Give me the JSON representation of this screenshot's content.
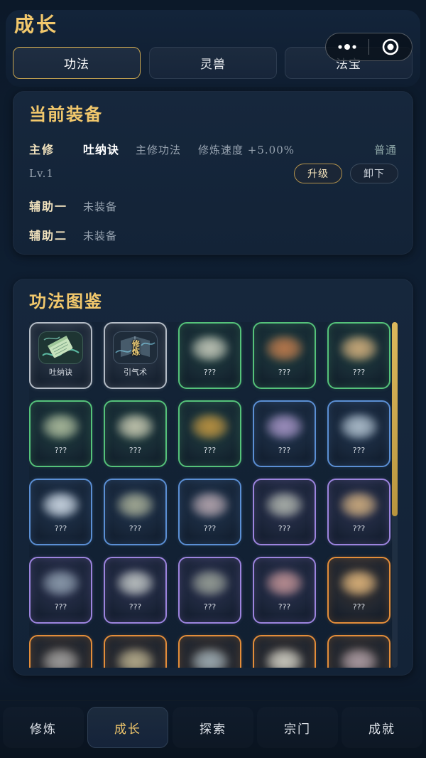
{
  "header": {
    "title": "成长"
  },
  "capsule": {
    "more_icon": "more-dots-icon",
    "close_icon": "target-circle-icon"
  },
  "tabs": [
    {
      "label": "功法",
      "selected": true
    },
    {
      "label": "灵兽",
      "selected": false
    },
    {
      "label": "法宝",
      "selected": false
    }
  ],
  "equipment": {
    "title": "当前装备",
    "main": {
      "slot_label": "主修",
      "name": "吐纳诀",
      "category": "主修功法",
      "effect": "修炼速度 +5.00%",
      "quality": "普通",
      "level": "Lv.1",
      "upgrade_label": "升级",
      "unequip_label": "卸下"
    },
    "aux": [
      {
        "slot_label": "辅助一",
        "value": "未装备"
      },
      {
        "slot_label": "辅助二",
        "value": "未装备"
      }
    ]
  },
  "codex": {
    "title": "功法图鉴",
    "items": [
      {
        "name": "吐纳诀",
        "unlocked": true,
        "icon": "jade-slip-icon",
        "frame_color": "#b4bcc6"
      },
      {
        "name": "引气术",
        "unlocked": true,
        "icon": "cultivation-manual-icon",
        "icon_text": "修炼",
        "frame_color": "#b4bcc6"
      },
      {
        "name": "???",
        "unlocked": false,
        "icon": "blurred-technique-icon",
        "frame_color": "#55c27a",
        "tint": "#c4c8ba"
      },
      {
        "name": "???",
        "unlocked": false,
        "icon": "blurred-technique-icon",
        "frame_color": "#55c27a",
        "tint": "#c07a4c"
      },
      {
        "name": "???",
        "unlocked": false,
        "icon": "blurred-technique-icon",
        "frame_color": "#55c27a",
        "tint": "#d2ae7c"
      },
      {
        "name": "???",
        "unlocked": false,
        "icon": "blurred-technique-icon",
        "frame_color": "#55c27a",
        "tint": "#aebc9e"
      },
      {
        "name": "???",
        "unlocked": false,
        "icon": "blurred-technique-icon",
        "frame_color": "#55c27a",
        "tint": "#c8c9b2"
      },
      {
        "name": "???",
        "unlocked": false,
        "icon": "blurred-technique-icon",
        "frame_color": "#55c27a",
        "tint": "#c09440"
      },
      {
        "name": "???",
        "unlocked": false,
        "icon": "blurred-technique-icon",
        "frame_color": "#5b8fd4",
        "tint": "#a594c4"
      },
      {
        "name": "???",
        "unlocked": false,
        "icon": "blurred-technique-icon",
        "frame_color": "#5b8fd4",
        "tint": "#b2c2cf"
      },
      {
        "name": "???",
        "unlocked": false,
        "icon": "blurred-technique-icon",
        "frame_color": "#5b8fd4",
        "tint": "#d0dbe6"
      },
      {
        "name": "???",
        "unlocked": false,
        "icon": "blurred-technique-icon",
        "frame_color": "#5b8fd4",
        "tint": "#a8ae96"
      },
      {
        "name": "???",
        "unlocked": false,
        "icon": "blurred-technique-icon",
        "frame_color": "#5b8fd4",
        "tint": "#b6a6ae"
      },
      {
        "name": "???",
        "unlocked": false,
        "icon": "blurred-technique-icon",
        "frame_color": "#9c84de",
        "tint": "#aeb4ac"
      },
      {
        "name": "???",
        "unlocked": false,
        "icon": "blurred-technique-icon",
        "frame_color": "#9c84de",
        "tint": "#d0ae7e"
      },
      {
        "name": "???",
        "unlocked": false,
        "icon": "blurred-technique-icon",
        "frame_color": "#9c84de",
        "tint": "#8e9eae"
      },
      {
        "name": "???",
        "unlocked": false,
        "icon": "blurred-technique-icon",
        "frame_color": "#9c84de",
        "tint": "#c0c6c4"
      },
      {
        "name": "???",
        "unlocked": false,
        "icon": "blurred-technique-icon",
        "frame_color": "#9c84de",
        "tint": "#98a096"
      },
      {
        "name": "???",
        "unlocked": false,
        "icon": "blurred-technique-icon",
        "frame_color": "#9c84de",
        "tint": "#c09294"
      },
      {
        "name": "???",
        "unlocked": false,
        "icon": "blurred-technique-icon",
        "frame_color": "#e38d3a",
        "tint": "#e0b67c"
      },
      {
        "unlocked": false,
        "icon": "blurred-technique-icon",
        "frame_color": "#e38d3a",
        "tint": "#a0a0a0"
      },
      {
        "unlocked": false,
        "icon": "blurred-technique-icon",
        "frame_color": "#e38d3a",
        "tint": "#b6ae8e"
      },
      {
        "unlocked": false,
        "icon": "blurred-technique-icon",
        "frame_color": "#e38d3a",
        "tint": "#9eaeb6"
      },
      {
        "unlocked": false,
        "icon": "blurred-technique-icon",
        "frame_color": "#e38d3a",
        "tint": "#d0d0c6"
      },
      {
        "unlocked": false,
        "icon": "blurred-technique-icon",
        "frame_color": "#e38d3a",
        "tint": "#ae9ea6"
      }
    ]
  },
  "bottom_nav": [
    {
      "label": "修炼",
      "selected": false
    },
    {
      "label": "成长",
      "selected": true
    },
    {
      "label": "探索",
      "selected": false
    },
    {
      "label": "宗门",
      "selected": false
    },
    {
      "label": "成就",
      "selected": false
    }
  ],
  "colors": {
    "accent_gold": "#f2c86c",
    "background": "#0d1a2b",
    "panel": "#15263b"
  }
}
